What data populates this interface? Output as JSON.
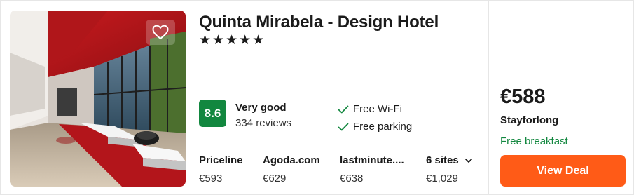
{
  "hotel": {
    "name": "Quinta Mirabela - Design Hotel",
    "stars_text": "★★★★★",
    "star_count": 5
  },
  "rating": {
    "score": "8.6",
    "label": "Very good",
    "reviews": "334 reviews",
    "color": "#12873f"
  },
  "amenities": [
    {
      "label": "Free Wi-Fi",
      "icon": "check-icon"
    },
    {
      "label": "Free parking",
      "icon": "check-icon"
    }
  ],
  "sites": [
    {
      "name": "Priceline",
      "price": "€593"
    },
    {
      "name": "Agoda.com",
      "price": "€629"
    },
    {
      "name": "lastminute....",
      "price": "€638"
    },
    {
      "name": "6 sites",
      "price": "€1,029",
      "icon": "chevron-down-icon"
    }
  ],
  "deal": {
    "price": "€588",
    "provider": "Stayforlong",
    "extra": "Free breakfast",
    "button_label": "View Deal",
    "button_color": "#ff5b17"
  },
  "favorite": {
    "icon": "heart-icon"
  }
}
